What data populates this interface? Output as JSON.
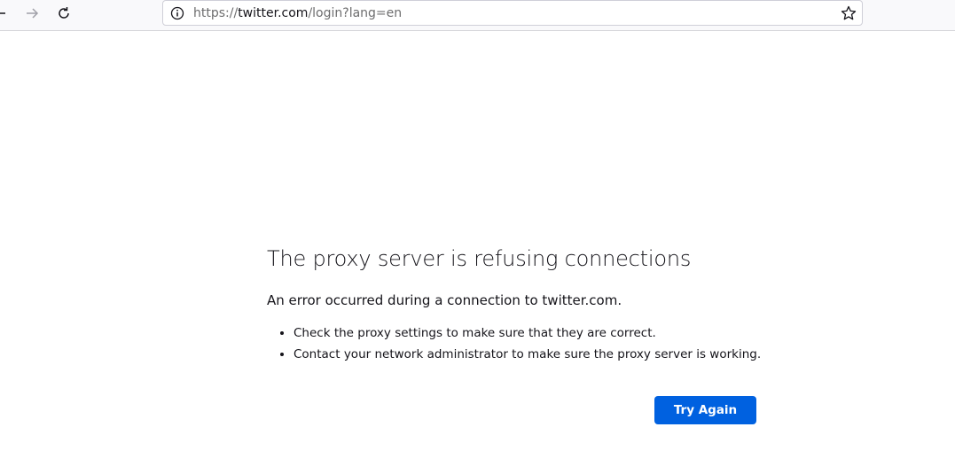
{
  "browser": {
    "url_prefix": "https://",
    "url_host": "twitter.com",
    "url_path": "/login?lang=en",
    "icons": {
      "back": "back-arrow-icon",
      "forward": "forward-arrow-icon",
      "reload": "reload-icon",
      "site_info": "info-icon",
      "bookmark": "star-icon"
    }
  },
  "error": {
    "title": "The proxy server is refusing connections",
    "short_desc": "An error occurred during a connection to twitter.com.",
    "items": [
      "Check the proxy settings to make sure that they are correct.",
      "Contact your network administrator to make sure the proxy server is working."
    ],
    "button_label": "Try Again"
  },
  "colors": {
    "accent": "#0061e0",
    "text": "#15141a",
    "url_dim": "#6d6d6e"
  }
}
